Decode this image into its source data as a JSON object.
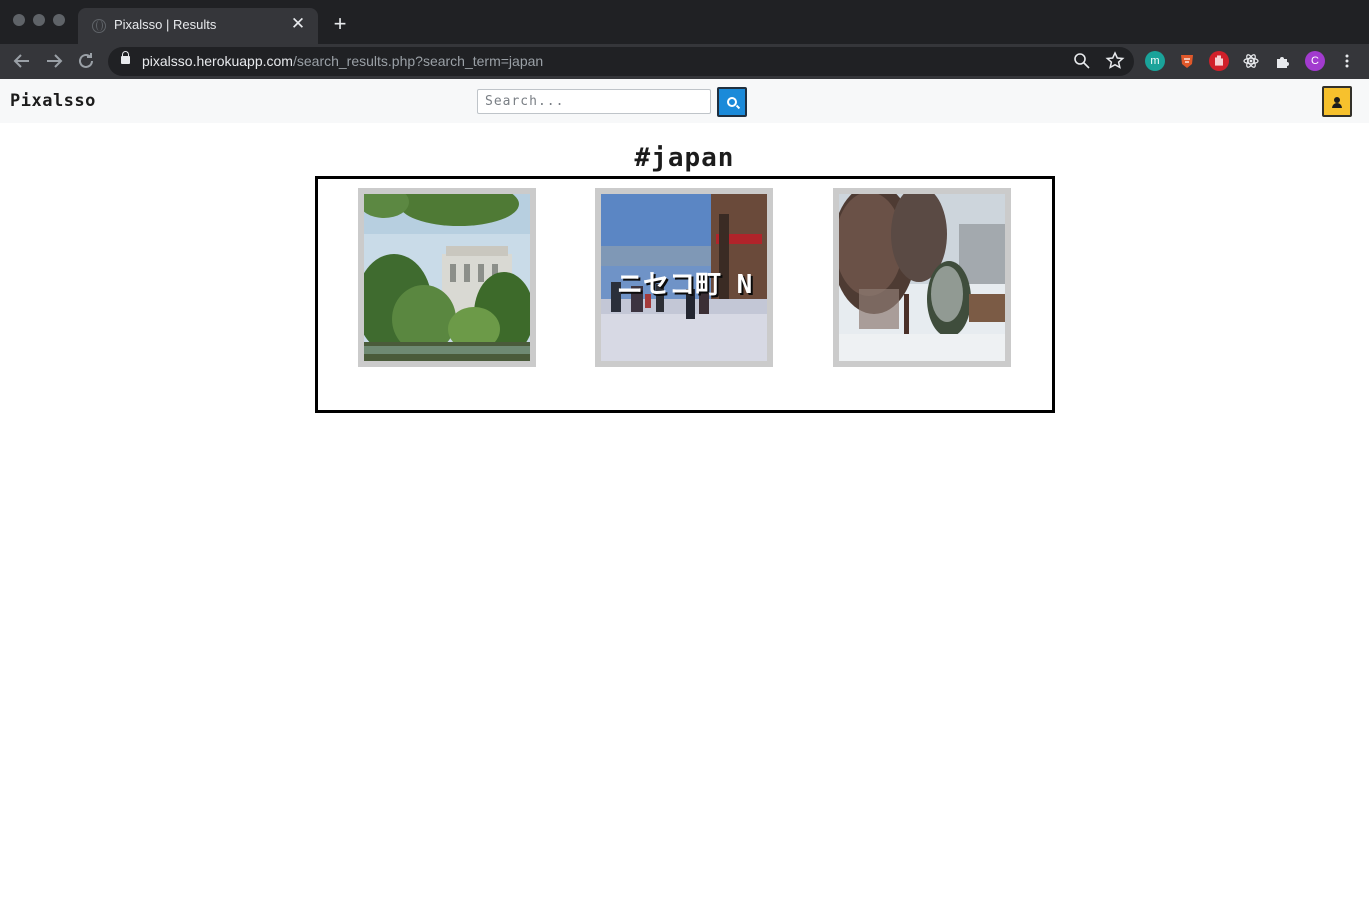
{
  "browser": {
    "tab_title": "Pixalsso | Results",
    "tab_close": "✕",
    "new_tab": "+",
    "url_host": "pixalsso.herokuapp.com",
    "url_path": "/search_results.php?search_term=japan",
    "ext_m_label": "m",
    "profile_initial": "C"
  },
  "site": {
    "brand": "Pixalsso",
    "search_placeholder": "Search...",
    "results_heading": "#japan",
    "results": [
      {
        "alt": "japanese garden with palace building"
      },
      {
        "alt": "snowy street in Niseko town",
        "caption": "ニセコ町 N"
      },
      {
        "alt": "snow covered pine trees"
      }
    ]
  },
  "colors": {
    "accent_blue": "#1b8ad9",
    "profile_yellow": "#f7c12d"
  }
}
